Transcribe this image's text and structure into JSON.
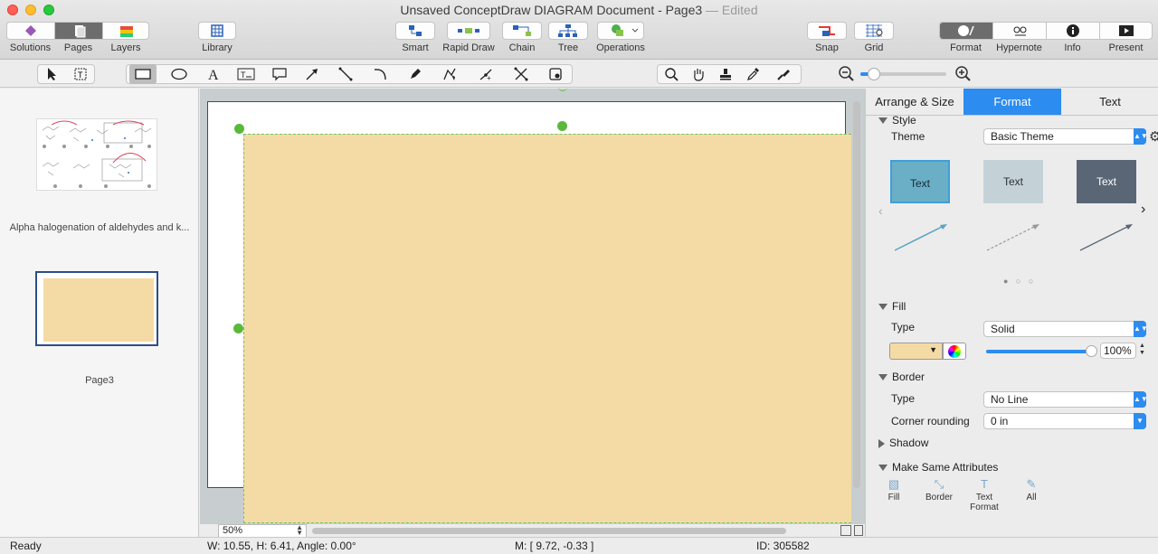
{
  "window": {
    "title": "Unsaved ConceptDraw DIAGRAM Document - Page3",
    "title_suffix": "— Edited"
  },
  "toolbar": {
    "left_tabs": [
      {
        "label": "Solutions",
        "icon": "solutions-icon"
      },
      {
        "label": "Pages",
        "icon": "pages-icon",
        "active": true
      },
      {
        "label": "Layers",
        "icon": "layers-icon"
      }
    ],
    "library": {
      "label": "Library",
      "icon": "library-icon"
    },
    "center": [
      {
        "label": "Smart",
        "icon": "smart-connector-icon"
      },
      {
        "label": "Rapid Draw",
        "icon": "rapid-draw-icon"
      },
      {
        "label": "Chain",
        "icon": "chain-icon"
      },
      {
        "label": "Tree",
        "icon": "tree-icon"
      },
      {
        "label": "Operations",
        "icon": "operations-icon"
      }
    ],
    "snap": {
      "label": "Snap",
      "icon": "snap-icon"
    },
    "grid": {
      "label": "Grid",
      "icon": "grid-icon"
    },
    "right_tabs": [
      {
        "label": "Format",
        "icon": "format-icon",
        "active": true
      },
      {
        "label": "Hypernote",
        "icon": "hypernote-icon"
      },
      {
        "label": "Info",
        "icon": "info-icon"
      },
      {
        "label": "Present",
        "icon": "present-icon"
      }
    ]
  },
  "tools": [
    "select-arrow-icon",
    "text-box-select-icon",
    "rectangle-icon",
    "ellipse-icon",
    "text-icon",
    "text-frame-icon",
    "callout-icon",
    "arrow-line-icon",
    "line-icon",
    "arc-icon",
    "pen-icon",
    "bezier-icon",
    "polyline-icon",
    "crossing-icon",
    "zoom-icon",
    "hand-icon",
    "stamp-icon",
    "eyedropper-icon",
    "format-painter-icon"
  ],
  "pages_panel": {
    "pages": [
      {
        "caption": "Alpha halogenation of aldehydes and k..."
      },
      {
        "caption": "Page3",
        "selected": true
      }
    ]
  },
  "canvas": {
    "zoom": "50%",
    "shape_fill": "#F4DBA5"
  },
  "format_panel": {
    "tabs": [
      "Arrange & Size",
      "Format",
      "Text"
    ],
    "active_tab": "Format",
    "style": {
      "section": "Style",
      "theme_label": "Theme",
      "theme_value": "Basic Theme",
      "theme_cards": [
        {
          "label": "Text",
          "bg": "#6AAFC6",
          "fg": "#1b2b33"
        },
        {
          "label": "Text",
          "bg": "#C4D2D8",
          "fg": "#2a3035"
        },
        {
          "label": "Text",
          "bg": "#5A6676",
          "fg": "#ffffff"
        }
      ]
    },
    "fill": {
      "section": "Fill",
      "type_label": "Type",
      "type_value": "Solid",
      "color": "#F4DBA5",
      "opacity": "100%"
    },
    "border": {
      "section": "Border",
      "type_label": "Type",
      "type_value": "No Line",
      "corner_label": "Corner rounding",
      "corner_value": "0 in"
    },
    "shadow": {
      "section": "Shadow"
    },
    "make_same": {
      "section": "Make Same Attributes",
      "items": [
        {
          "label": "Fill",
          "icon": "fill-icon"
        },
        {
          "label": "Border",
          "icon": "border-icon"
        },
        {
          "label": "Text Format",
          "icon": "text-format-icon"
        },
        {
          "label": "All",
          "icon": "all-attributes-icon"
        }
      ]
    }
  },
  "status": {
    "state": "Ready",
    "dimensions": "W: 10.55,  H: 6.41,  Angle: 0.00°",
    "mouse": "M: [ 9.72, -0.33 ]",
    "id": "ID: 305582"
  }
}
